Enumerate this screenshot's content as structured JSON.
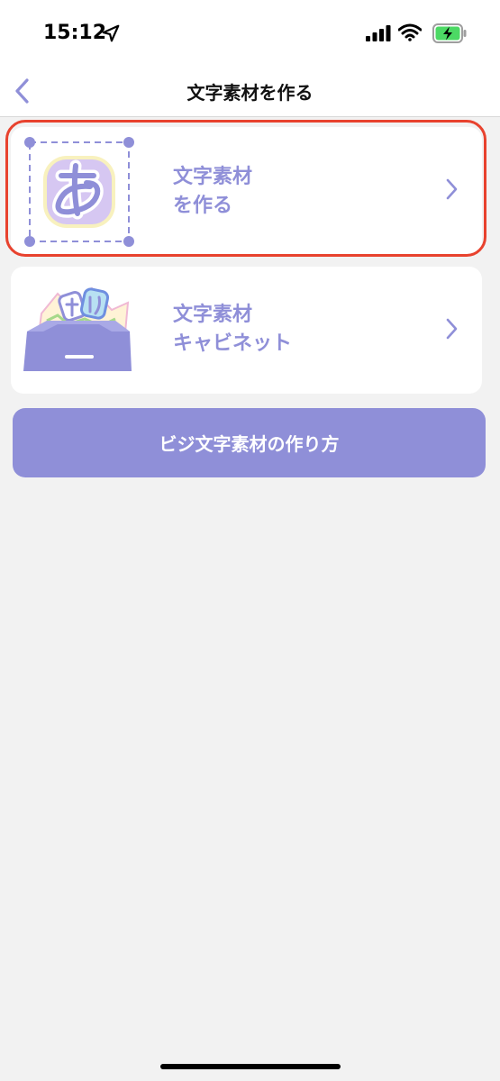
{
  "status_bar": {
    "time": "15:12",
    "icons": [
      "location-arrow-icon",
      "signal-icon",
      "wifi-icon",
      "battery-charging-icon"
    ]
  },
  "nav": {
    "title": "文字素材を作る",
    "back_icon": "chevron-left-icon"
  },
  "menu": {
    "items": [
      {
        "label": "文字素材\nを作る",
        "icon": "hiragana-a-frame-icon",
        "selected": true
      },
      {
        "label": "文字素材\nキャビネット",
        "icon": "drawer-cabinet-icon",
        "selected": false
      }
    ]
  },
  "howto_button": {
    "label": "ビジ文字素材の作り方"
  },
  "colors": {
    "accent": "#8f8fd8",
    "highlight": "#e8422e",
    "background": "#f2f2f2",
    "card": "#ffffff"
  }
}
